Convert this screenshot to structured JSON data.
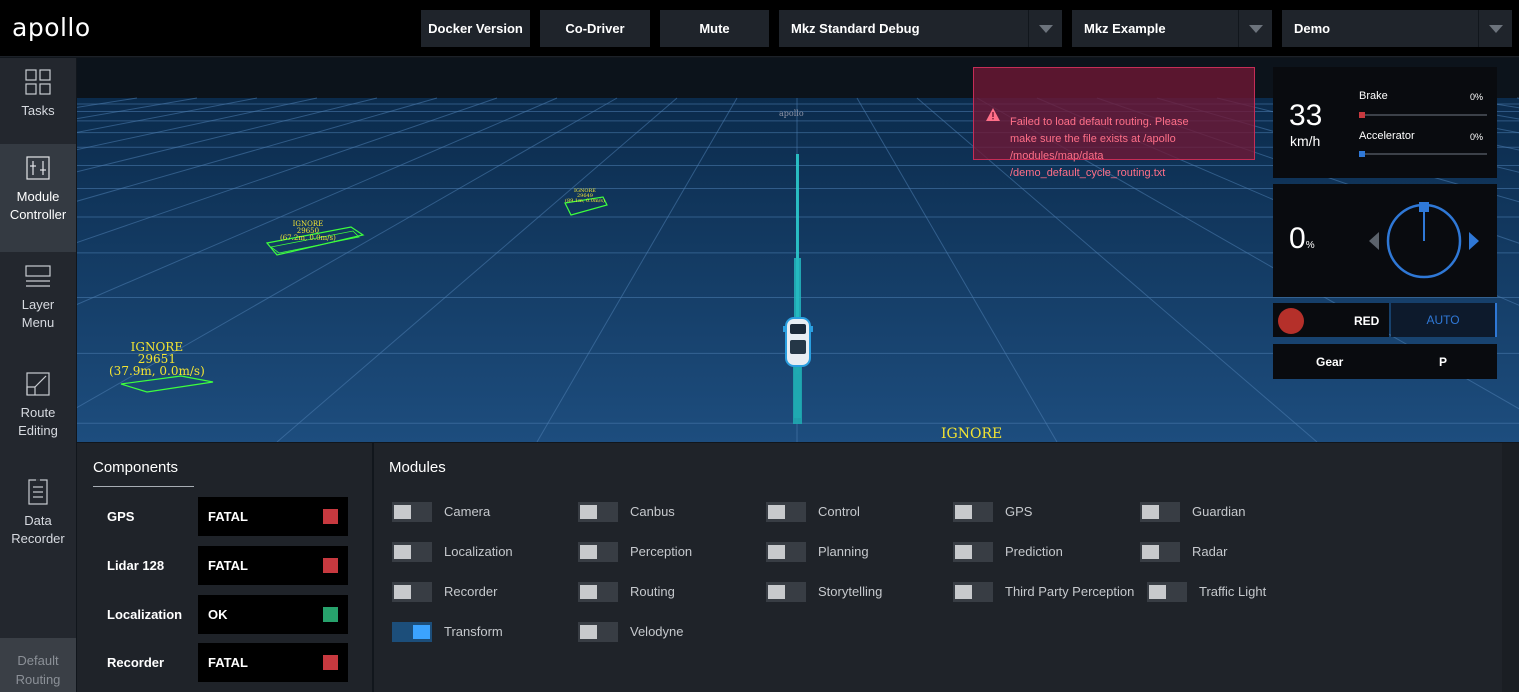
{
  "app": {
    "logo": "apollo"
  },
  "header": {
    "docker_label": "Docker Version",
    "codriver_label": "Co-Driver",
    "mute_label": "Mute",
    "mode_select": "Mkz Standard Debug",
    "vehicle_select": "Mkz Example",
    "map_select": "Demo"
  },
  "sidebar": {
    "items": [
      {
        "label": "Tasks",
        "icon": "grid-icon"
      },
      {
        "label": "Module\nController",
        "icon": "sliders-icon"
      },
      {
        "label": "Layer\nMenu",
        "icon": "layers-icon"
      },
      {
        "label": "Route\nEditing",
        "icon": "route-icon"
      },
      {
        "label": "Data\nRecorder",
        "icon": "document-icon"
      }
    ],
    "bottom_label": "Default\nRouting"
  },
  "scene": {
    "obstacle_labels": [
      {
        "line1": "IGNORE",
        "line2": "29651",
        "line3": "(37.9m, 0.0m/s)"
      },
      {
        "line1": "IGNORE",
        "line2": "29650",
        "line3": "(67.2m, 0.0m/s)"
      },
      {
        "line1": "IGNORE",
        "line2": "29649",
        "line3": "(89.1m, 0.0m/s)"
      }
    ],
    "bottom_label": "IGNORE",
    "far_label": "apollo"
  },
  "alert": {
    "message": "Failed to load default routing. Please\nmake sure the file exists at /apollo\n/modules/map/data\n/demo_default_cycle_routing.txt",
    "icon": "warning-icon"
  },
  "dashboard": {
    "speed": "33",
    "speed_unit": "km/h",
    "brake_label": "Brake",
    "brake_pct": "0%",
    "brake_value": 0,
    "accel_label": "Accelerator",
    "accel_pct": "0%",
    "accel_value": 0,
    "steering_pct": "0",
    "steering_unit": "%",
    "traffic_light": "RED",
    "driving_mode": "AUTO",
    "gear_label": "Gear",
    "gear_value": "P"
  },
  "colors": {
    "fatal": "#c7393f",
    "ok": "#27a26c",
    "brake": "#c7393f",
    "accelerator": "#2f78d6"
  },
  "components": {
    "title": "Components",
    "rows": [
      {
        "name": "GPS",
        "status": "FATAL"
      },
      {
        "name": "Lidar 128",
        "status": "FATAL"
      },
      {
        "name": "Localization",
        "status": "OK"
      },
      {
        "name": "Recorder",
        "status": "FATAL"
      }
    ]
  },
  "modules": {
    "title": "Modules",
    "items": [
      {
        "label": "Camera",
        "on": false
      },
      {
        "label": "Canbus",
        "on": false
      },
      {
        "label": "Control",
        "on": false
      },
      {
        "label": "GPS",
        "on": false
      },
      {
        "label": "Guardian",
        "on": false
      },
      {
        "label": "Localization",
        "on": false
      },
      {
        "label": "Perception",
        "on": false
      },
      {
        "label": "Planning",
        "on": false
      },
      {
        "label": "Prediction",
        "on": false
      },
      {
        "label": "Radar",
        "on": false
      },
      {
        "label": "Recorder",
        "on": false
      },
      {
        "label": "Routing",
        "on": false
      },
      {
        "label": "Storytelling",
        "on": false
      },
      {
        "label": "Third Party Perception",
        "on": false
      },
      {
        "label": "Traffic Light",
        "on": false
      },
      {
        "label": "Transform",
        "on": true
      },
      {
        "label": "Velodyne",
        "on": false
      }
    ]
  }
}
